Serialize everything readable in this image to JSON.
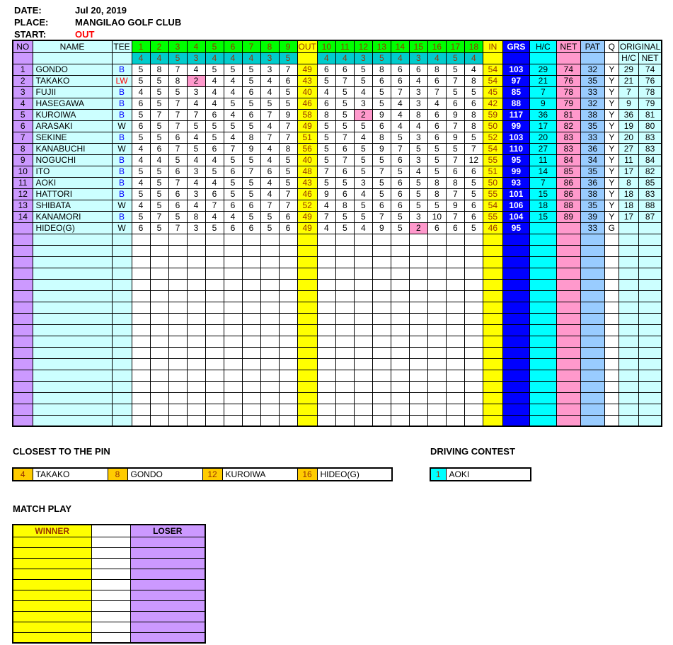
{
  "info": {
    "date_label": "DATE:",
    "date_value": "Jul 20, 2019",
    "place_label": "PLACE:",
    "place_value": "MANGILAO GOLF CLUB",
    "start_label": "START:",
    "start_value": "OUT"
  },
  "colors": {
    "hole_header": "#00FF00",
    "total_col": "#FFFF00",
    "par_row": "#00CCCC",
    "grs_col": "#0000FF",
    "hc_col": "#00FFFF",
    "net_col": "#FF99CC",
    "pat_col": "#99CCFF",
    "original_col": "#CCFFFF",
    "no_col": "#CC99FF",
    "name_col": "#CCFFFF",
    "highlight": "#FF99CC",
    "pin_cell": "#FFCC00",
    "drive_cell": "#00FFFF",
    "winner": "#FFFF00",
    "loser": "#CC99FF",
    "dark_red_text": "#993300",
    "red_text": "#FF0000",
    "blue_text": "#0000FF"
  },
  "table": {
    "headers": {
      "no": "NO",
      "name": "NAME",
      "tee": "TEE",
      "out_holes": [
        "1",
        "2",
        "3",
        "4",
        "5",
        "6",
        "7",
        "8",
        "9"
      ],
      "out": "OUT",
      "in_holes": [
        "10",
        "11",
        "12",
        "13",
        "14",
        "15",
        "16",
        "17",
        "18"
      ],
      "in": "IN",
      "grs": "GRS",
      "hc": "H/C",
      "net": "NET",
      "pat": "PAT",
      "q": "Q",
      "original": "ORIGINAL",
      "orig_hc": "H/C",
      "orig_net": "NET"
    },
    "par_out": [
      4,
      4,
      5,
      3,
      4,
      4,
      4,
      3,
      5
    ],
    "par_in": [
      4,
      4,
      3,
      5,
      4,
      3,
      4,
      5,
      4
    ],
    "players": [
      {
        "no": "1",
        "name": "GONDO",
        "tee": "B",
        "out": [
          5,
          8,
          7,
          4,
          5,
          5,
          5,
          3,
          7
        ],
        "out_total": 49,
        "in": [
          6,
          6,
          5,
          8,
          6,
          6,
          8,
          5,
          4
        ],
        "in_total": 54,
        "grs": 103,
        "hc": 29,
        "net": 74,
        "pat": 32,
        "q": "Y",
        "orig_hc": 29,
        "orig_net": 74,
        "pink_out": [],
        "pink_in": []
      },
      {
        "no": "2",
        "name": "TAKAKO",
        "tee": "LW",
        "out": [
          5,
          5,
          8,
          2,
          4,
          4,
          5,
          4,
          6
        ],
        "out_total": 43,
        "in": [
          5,
          7,
          5,
          6,
          6,
          4,
          6,
          7,
          8
        ],
        "in_total": 54,
        "grs": 97,
        "hc": 21,
        "net": 76,
        "pat": 35,
        "q": "Y",
        "orig_hc": 21,
        "orig_net": 76,
        "pink_out": [
          3
        ],
        "pink_in": []
      },
      {
        "no": "3",
        "name": "FUJII",
        "tee": "B",
        "out": [
          4,
          5,
          5,
          3,
          4,
          4,
          6,
          4,
          5
        ],
        "out_total": 40,
        "in": [
          4,
          5,
          4,
          5,
          7,
          3,
          7,
          5,
          5
        ],
        "in_total": 45,
        "grs": 85,
        "hc": 7,
        "net": 78,
        "pat": 33,
        "q": "Y",
        "orig_hc": 7,
        "orig_net": 78,
        "pink_out": [],
        "pink_in": []
      },
      {
        "no": "4",
        "name": "HASEGAWA",
        "tee": "B",
        "out": [
          6,
          5,
          7,
          4,
          4,
          5,
          5,
          5,
          5
        ],
        "out_total": 46,
        "in": [
          6,
          5,
          3,
          5,
          4,
          3,
          4,
          6,
          6
        ],
        "in_total": 42,
        "grs": 88,
        "hc": 9,
        "net": 79,
        "pat": 32,
        "q": "Y",
        "orig_hc": 9,
        "orig_net": 79,
        "pink_out": [],
        "pink_in": []
      },
      {
        "no": "5",
        "name": "KUROIWA",
        "tee": "B",
        "out": [
          5,
          7,
          7,
          7,
          6,
          4,
          6,
          7,
          9
        ],
        "out_total": 58,
        "in": [
          8,
          5,
          2,
          9,
          4,
          8,
          6,
          9,
          8
        ],
        "in_total": 59,
        "grs": 117,
        "hc": 36,
        "net": 81,
        "pat": 38,
        "q": "Y",
        "orig_hc": 36,
        "orig_net": 81,
        "pink_out": [],
        "pink_in": [
          2
        ]
      },
      {
        "no": "6",
        "name": "ARASAKI",
        "tee": "W",
        "out": [
          6,
          5,
          7,
          5,
          5,
          5,
          5,
          4,
          7
        ],
        "out_total": 49,
        "in": [
          5,
          5,
          5,
          6,
          4,
          4,
          6,
          7,
          8
        ],
        "in_total": 50,
        "grs": 99,
        "hc": 17,
        "net": 82,
        "pat": 35,
        "q": "Y",
        "orig_hc": 19,
        "orig_net": 80,
        "pink_out": [],
        "pink_in": []
      },
      {
        "no": "7",
        "name": "SEKINE",
        "tee": "B",
        "out": [
          5,
          5,
          6,
          4,
          5,
          4,
          8,
          7,
          7
        ],
        "out_total": 51,
        "in": [
          5,
          7,
          4,
          8,
          5,
          3,
          6,
          9,
          5
        ],
        "in_total": 52,
        "grs": 103,
        "hc": 20,
        "net": 83,
        "pat": 33,
        "q": "Y",
        "orig_hc": 20,
        "orig_net": 83,
        "pink_out": [],
        "pink_in": []
      },
      {
        "no": "8",
        "name": "KANABUCHI",
        "tee": "W",
        "out": [
          4,
          6,
          7,
          5,
          6,
          7,
          9,
          4,
          8
        ],
        "out_total": 56,
        "in": [
          5,
          6,
          5,
          9,
          7,
          5,
          5,
          5,
          7
        ],
        "in_total": 54,
        "grs": 110,
        "hc": 27,
        "net": 83,
        "pat": 36,
        "q": "Y",
        "orig_hc": 27,
        "orig_net": 83,
        "pink_out": [],
        "pink_in": []
      },
      {
        "no": "9",
        "name": "NOGUCHI",
        "tee": "B",
        "out": [
          4,
          4,
          5,
          4,
          4,
          5,
          5,
          4,
          5
        ],
        "out_total": 40,
        "in": [
          5,
          7,
          5,
          5,
          6,
          3,
          5,
          7,
          12
        ],
        "in_total": 55,
        "grs": 95,
        "hc": 11,
        "net": 84,
        "pat": 34,
        "q": "Y",
        "orig_hc": 11,
        "orig_net": 84,
        "pink_out": [],
        "pink_in": []
      },
      {
        "no": "10",
        "name": "ITO",
        "tee": "B",
        "out": [
          5,
          5,
          6,
          3,
          5,
          6,
          7,
          6,
          5
        ],
        "out_total": 48,
        "in": [
          7,
          6,
          5,
          7,
          5,
          4,
          5,
          6,
          6
        ],
        "in_total": 51,
        "grs": 99,
        "hc": 14,
        "net": 85,
        "pat": 35,
        "q": "Y",
        "orig_hc": 17,
        "orig_net": 82,
        "pink_out": [],
        "pink_in": []
      },
      {
        "no": "11",
        "name": "AOKI",
        "tee": "B",
        "out": [
          4,
          5,
          7,
          4,
          4,
          5,
          5,
          4,
          5
        ],
        "out_total": 43,
        "in": [
          5,
          5,
          3,
          5,
          6,
          5,
          8,
          8,
          5
        ],
        "in_total": 50,
        "grs": 93,
        "hc": 7,
        "net": 86,
        "pat": 36,
        "q": "Y",
        "orig_hc": 8,
        "orig_net": 85,
        "pink_out": [],
        "pink_in": []
      },
      {
        "no": "12",
        "name": "HATTORI",
        "tee": "B",
        "out": [
          5,
          5,
          6,
          3,
          6,
          5,
          5,
          4,
          7
        ],
        "out_total": 46,
        "in": [
          9,
          6,
          4,
          5,
          6,
          5,
          8,
          7,
          5
        ],
        "in_total": 55,
        "grs": 101,
        "hc": 15,
        "net": 86,
        "pat": 38,
        "q": "Y",
        "orig_hc": 18,
        "orig_net": 83,
        "pink_out": [],
        "pink_in": []
      },
      {
        "no": "13",
        "name": "SHIBATA",
        "tee": "W",
        "out": [
          4,
          5,
          6,
          4,
          7,
          6,
          6,
          7,
          7
        ],
        "out_total": 52,
        "in": [
          4,
          8,
          5,
          6,
          6,
          5,
          5,
          9,
          6
        ],
        "in_total": 54,
        "grs": 106,
        "hc": 18,
        "net": 88,
        "pat": 35,
        "q": "Y",
        "orig_hc": 18,
        "orig_net": 88,
        "pink_out": [],
        "pink_in": []
      },
      {
        "no": "14",
        "name": "KANAMORI",
        "tee": "B",
        "out": [
          5,
          7,
          5,
          8,
          4,
          4,
          5,
          5,
          6
        ],
        "out_total": 49,
        "in": [
          7,
          5,
          5,
          7,
          5,
          3,
          10,
          7,
          6
        ],
        "in_total": 55,
        "grs": 104,
        "hc": 15,
        "net": 89,
        "pat": 39,
        "q": "Y",
        "orig_hc": 17,
        "orig_net": 87,
        "pink_out": [],
        "pink_in": []
      },
      {
        "no": "",
        "name": "HIDEO(G)",
        "tee": "W",
        "out": [
          6,
          5,
          7,
          3,
          5,
          6,
          6,
          5,
          6
        ],
        "out_total": 49,
        "in": [
          4,
          5,
          4,
          9,
          5,
          2,
          6,
          6,
          5
        ],
        "in_total": 46,
        "grs": 95,
        "hc": "",
        "net": "",
        "pat": 33,
        "q": "G",
        "orig_hc": "",
        "orig_net": "",
        "pink_out": [],
        "pink_in": [
          5
        ]
      }
    ],
    "empty_rows": 17
  },
  "closest_to_pin": {
    "title": "CLOSEST TO THE PIN",
    "entries": [
      {
        "hole": "4",
        "name": "TAKAKO"
      },
      {
        "hole": "8",
        "name": "GONDO"
      },
      {
        "hole": "12",
        "name": "KUROIWA"
      },
      {
        "hole": "16",
        "name": "HIDEO(G)"
      }
    ]
  },
  "driving_contest": {
    "title": "DRIVING CONTEST",
    "entries": [
      {
        "hole": "1",
        "name": "AOKI"
      }
    ]
  },
  "match_play": {
    "title": "MATCH PLAY",
    "winner_label": "WINNER",
    "loser_label": "LOSER",
    "empty_rows": 10,
    "rows": []
  }
}
